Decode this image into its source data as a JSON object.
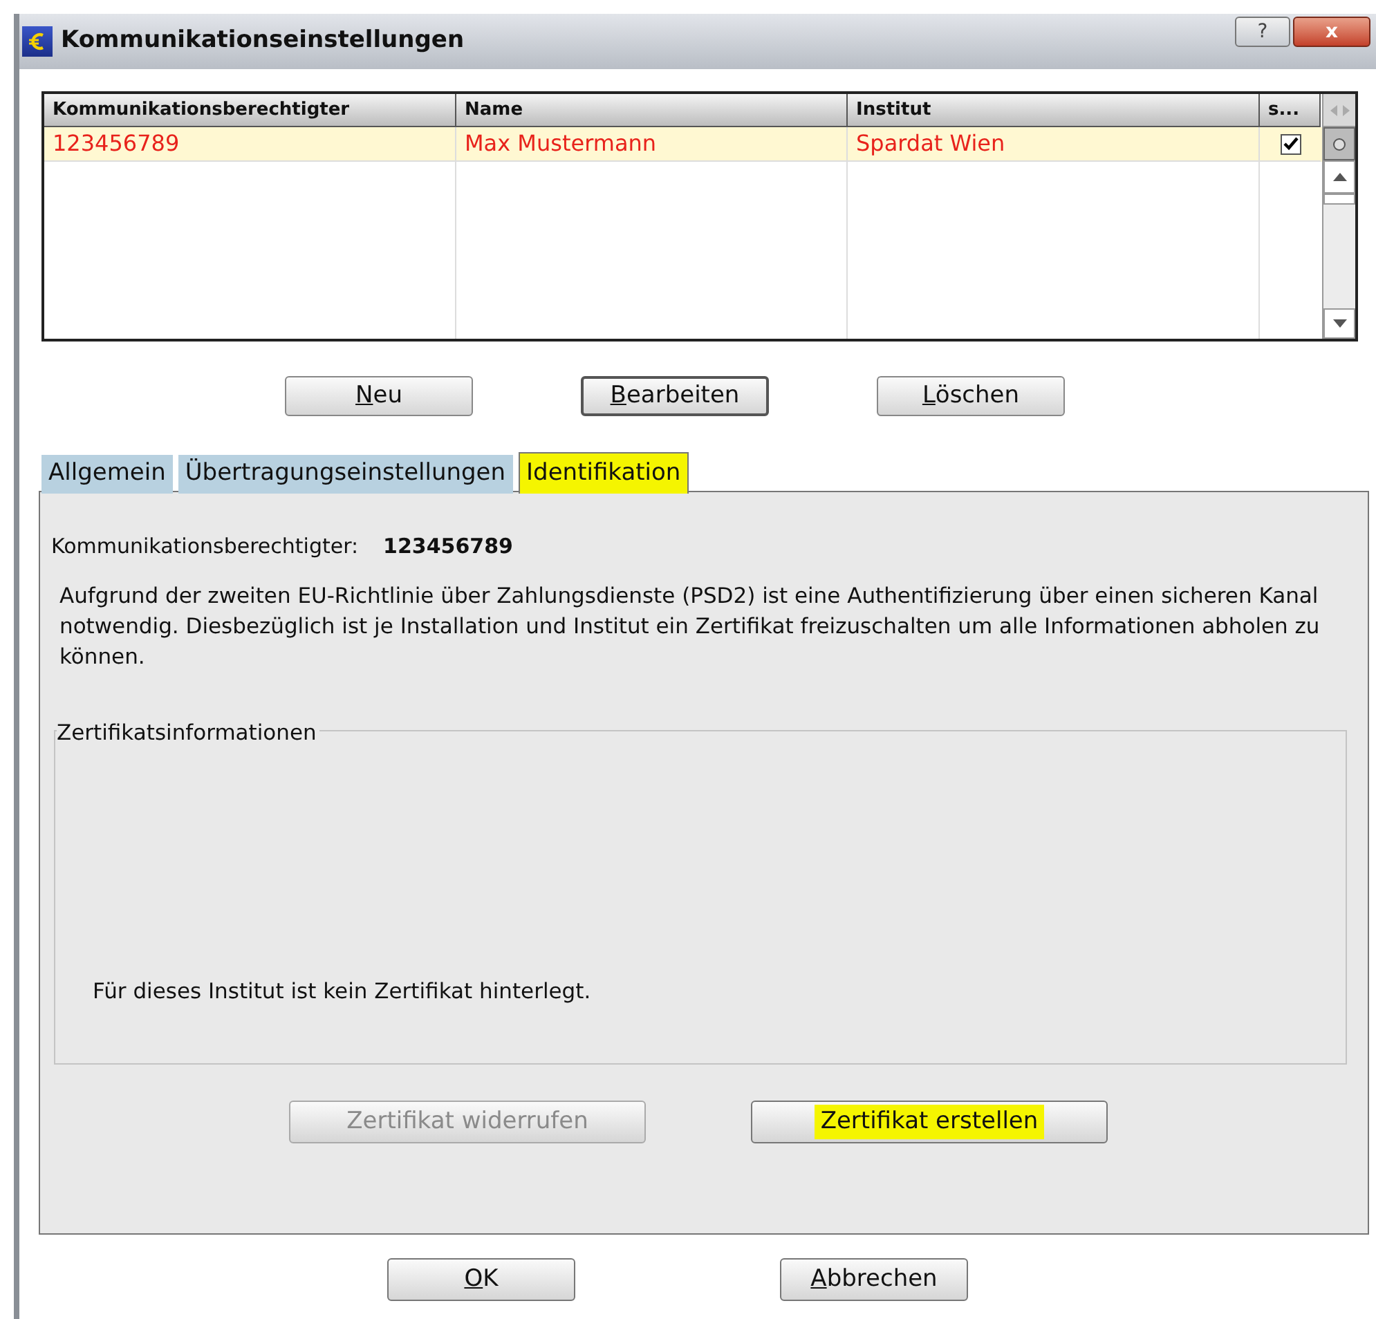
{
  "window": {
    "title": "Kommunikationseinstellungen",
    "help_button": "?",
    "close_button": "x"
  },
  "table": {
    "columns": [
      "Kommunikationsberechtigter",
      "Name",
      "Institut",
      "s..."
    ],
    "rows": [
      {
        "cells": [
          "123456789",
          "Max Mustermann",
          "Spardat Wien"
        ],
        "checked": true,
        "selected": true
      }
    ]
  },
  "table_buttons": [
    {
      "label": "Neu",
      "mnemonic_underlined": true,
      "focused": false
    },
    {
      "label": "Bearbeiten",
      "mnemonic_underlined": true,
      "focused": true
    },
    {
      "label": "Löschen",
      "mnemonic_underlined": true,
      "focused": false
    }
  ],
  "tabs": [
    {
      "label": "Allgemein",
      "selected": false
    },
    {
      "label": "Übertragungseinstellungen",
      "selected": false
    },
    {
      "label": "Identifikation",
      "selected": true,
      "highlighted": true
    }
  ],
  "identification": {
    "label": "Kommunikationsberechtigter:",
    "value": "123456789",
    "description": "Aufgrund der zweiten EU-Richtlinie über Zahlungsdienste (PSD2) ist eine Authentifizierung über einen sicheren Kanal notwendig. Diesbezüglich ist je Installation und Institut ein Zertifikat freizuschalten um alle Informationen abholen zu können.",
    "group_title": "Zertifikatsinformationen",
    "message": "Für dieses Institut ist kein Zertifikat hinterlegt.",
    "buttons": [
      {
        "label": "Zertifikat widerrufen",
        "disabled": true,
        "highlighted": false
      },
      {
        "label": "Zertifikat erstellen",
        "disabled": false,
        "highlighted": true
      }
    ]
  },
  "dialog_buttons": [
    {
      "label": "OK",
      "mnemonic_underlined": true
    },
    {
      "label": "Abbrechen",
      "mnemonic_underlined": true
    }
  ]
}
